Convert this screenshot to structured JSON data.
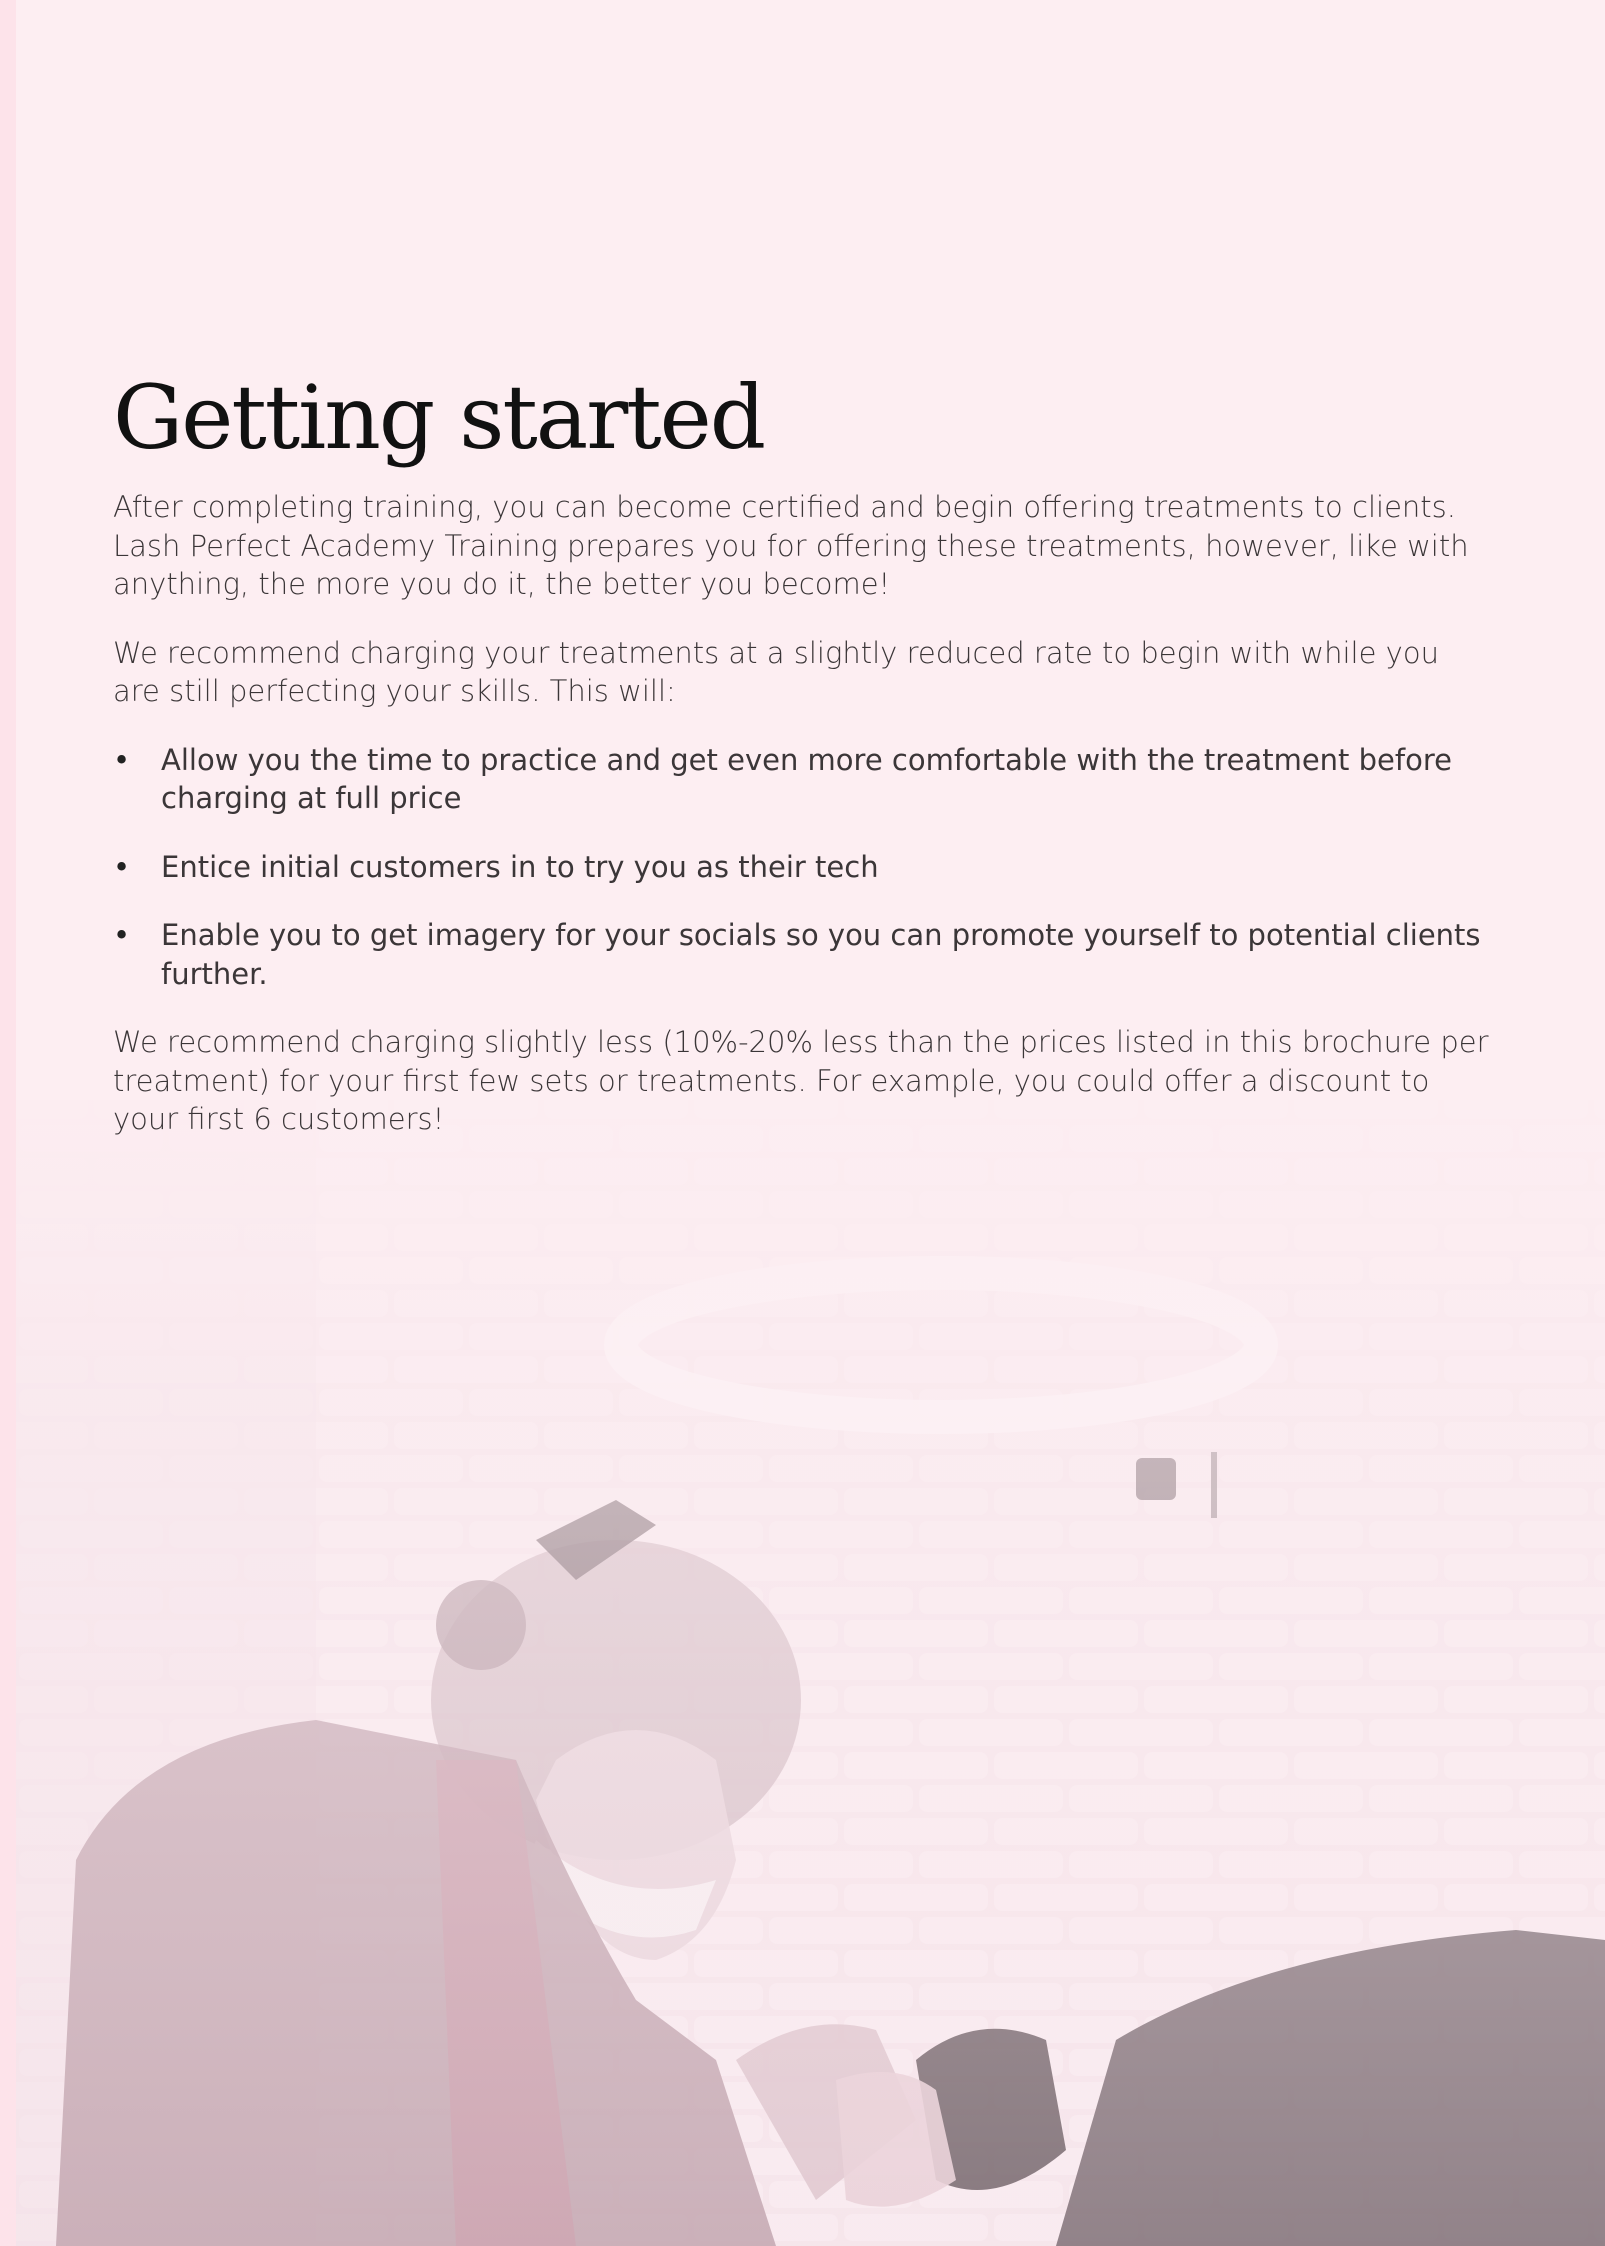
{
  "page": {
    "title": "Getting started",
    "paragraphs": [
      "After completing training, you can become certified and begin offering treatments to clients. Lash Perfect Academy Training prepares you for offering these treatments, however, like with anything, the more you do it, the better you become!",
      "We recommend charging your treatments at a slightly reduced rate to begin with while you are still perfecting your skills. This will:"
    ],
    "bullets": [
      "Allow you the time to practice and get even more comfortable with the treatment before charging at full price",
      "Entice initial customers in to try you as their tech",
      "Enable you to get imagery for your socials so you can promote yourself to potential clients further."
    ],
    "closing": "We recommend charging slightly less (10%-20% less than the prices listed in this brochure per treatment) for your first few sets or treatments. For example, you could offer a discount to your first 6 customers!"
  },
  "colors": {
    "background": "#fdeef2",
    "text": "#3b3638",
    "title": "#111111"
  }
}
